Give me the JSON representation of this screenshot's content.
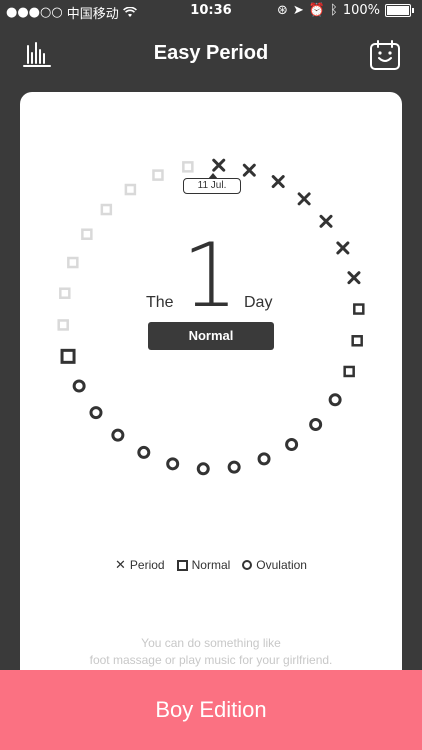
{
  "statusbar": {
    "carrier": "中国移动",
    "time": "10:36",
    "battery": "100%"
  },
  "nav": {
    "title": "Easy Period",
    "left_icon": "bar-chart-icon",
    "right_icon": "calendar-smile-icon"
  },
  "cycle": {
    "prefix": "The",
    "day": "1",
    "suffix": "Day",
    "status": "Normal",
    "selected_date": "11 Jul.",
    "markers": [
      "period",
      "period",
      "period",
      "period",
      "period",
      "period",
      "period",
      "normal",
      "normal",
      "normal",
      "ovulation",
      "ovulation",
      "ovulation",
      "ovulation",
      "ovulation",
      "ovulation",
      "ovulation",
      "ovulation",
      "ovulation",
      "ovulation",
      "ovulation",
      "normal-current",
      "normal-light",
      "normal-light",
      "normal-light",
      "normal-light",
      "normal-light",
      "normal-light",
      "normal-light",
      "normal-light"
    ]
  },
  "legend": {
    "period": "Period",
    "normal": "Normal",
    "ovulation": "Ovulation"
  },
  "tip": {
    "line1": "You can do something like",
    "line2": "foot massage or play music for your girlfriend."
  },
  "bottom_button": "Boy Edition",
  "colors": {
    "background": "#3a3a3a",
    "accent": "#fb7182",
    "marker_dark": "#333333",
    "marker_light": "#d9d9d9"
  }
}
